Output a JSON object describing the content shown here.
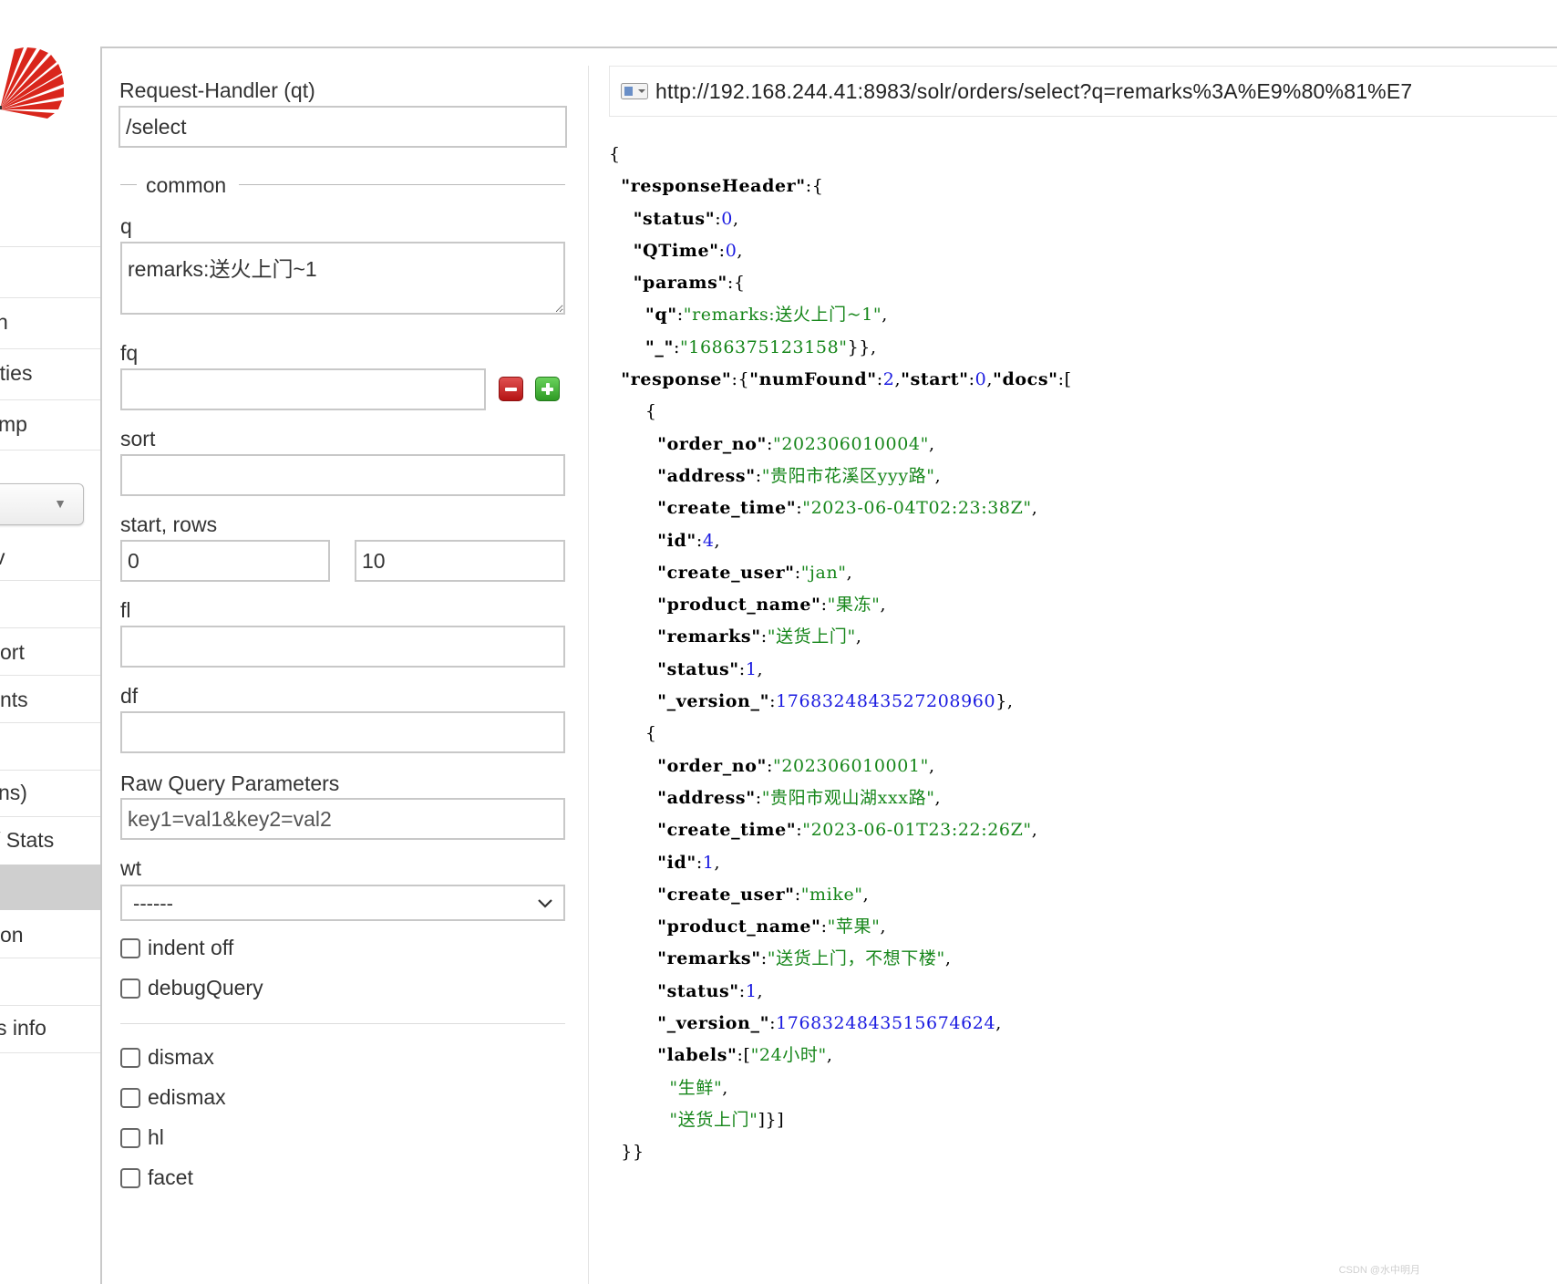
{
  "sidebar": {
    "items": [
      {
        "label": "n"
      },
      {
        "label": "rties"
      },
      {
        "label": "mp"
      },
      {
        "label": "v"
      },
      {
        "label": "ort"
      },
      {
        "label": "nts"
      },
      {
        "label": "ns)"
      },
      {
        "label": "/ Stats"
      },
      {
        "label": "on"
      },
      {
        "label": "s info"
      }
    ],
    "core_selector": {
      "value": ""
    }
  },
  "form": {
    "request_handler": {
      "label": "Request-Handler (qt)",
      "value": "/select"
    },
    "common_legend": "common",
    "q": {
      "label": "q",
      "value": "remarks:送火上门~1"
    },
    "fq": {
      "label": "fq",
      "value": ""
    },
    "sort": {
      "label": "sort",
      "value": ""
    },
    "start_rows": {
      "label": "start, rows",
      "start": "0",
      "rows": "10"
    },
    "fl": {
      "label": "fl",
      "value": ""
    },
    "df": {
      "label": "df",
      "value": ""
    },
    "raw_params": {
      "label": "Raw Query Parameters",
      "placeholder": "key1=val1&key2=val2"
    },
    "wt": {
      "label": "wt",
      "selected": "------"
    },
    "indent_off": "indent off",
    "debug_query": "debugQuery",
    "dismax": "dismax",
    "edismax": "edismax",
    "hl": "hl",
    "facet": "facet"
  },
  "results": {
    "url": "http://192.168.244.41:8983/solr/orders/select?q=remarks%3A%E9%80%81%E7",
    "json_lines": [
      [
        [
          "p",
          "{"
        ]
      ],
      [
        [
          "p",
          "  "
        ],
        [
          "k",
          "\"responseHeader\""
        ],
        [
          "p",
          ":{"
        ]
      ],
      [
        [
          "p",
          "    "
        ],
        [
          "k",
          "\"status\""
        ],
        [
          "p",
          ":"
        ],
        [
          "n",
          "0"
        ],
        [
          "p",
          ","
        ]
      ],
      [
        [
          "p",
          "    "
        ],
        [
          "k",
          "\"QTime\""
        ],
        [
          "p",
          ":"
        ],
        [
          "n",
          "0"
        ],
        [
          "p",
          ","
        ]
      ],
      [
        [
          "p",
          "    "
        ],
        [
          "k",
          "\"params\""
        ],
        [
          "p",
          ":{"
        ]
      ],
      [
        [
          "p",
          "      "
        ],
        [
          "k",
          "\"q\""
        ],
        [
          "p",
          ":"
        ],
        [
          "s",
          "\"remarks:送火上门~1\""
        ],
        [
          "p",
          ","
        ]
      ],
      [
        [
          "p",
          "      "
        ],
        [
          "k",
          "\"_\""
        ],
        [
          "p",
          ":"
        ],
        [
          "s",
          "\"1686375123158\""
        ],
        [
          "p",
          "}},"
        ]
      ],
      [
        [
          "p",
          "  "
        ],
        [
          "k",
          "\"response\""
        ],
        [
          "p",
          ":{"
        ],
        [
          "k",
          "\"numFound\""
        ],
        [
          "p",
          ":"
        ],
        [
          "n",
          "2"
        ],
        [
          "p",
          ","
        ],
        [
          "k",
          "\"start\""
        ],
        [
          "p",
          ":"
        ],
        [
          "n",
          "0"
        ],
        [
          "p",
          ","
        ],
        [
          "k",
          "\"docs\""
        ],
        [
          "p",
          ":["
        ]
      ],
      [
        [
          "p",
          "      {"
        ]
      ],
      [
        [
          "p",
          "        "
        ],
        [
          "k",
          "\"order_no\""
        ],
        [
          "p",
          ":"
        ],
        [
          "s",
          "\"202306010004\""
        ],
        [
          "p",
          ","
        ]
      ],
      [
        [
          "p",
          "        "
        ],
        [
          "k",
          "\"address\""
        ],
        [
          "p",
          ":"
        ],
        [
          "s",
          "\"贵阳市花溪区yyy路\""
        ],
        [
          "p",
          ","
        ]
      ],
      [
        [
          "p",
          "        "
        ],
        [
          "k",
          "\"create_time\""
        ],
        [
          "p",
          ":"
        ],
        [
          "s",
          "\"2023-06-04T02:23:38Z\""
        ],
        [
          "p",
          ","
        ]
      ],
      [
        [
          "p",
          "        "
        ],
        [
          "k",
          "\"id\""
        ],
        [
          "p",
          ":"
        ],
        [
          "n",
          "4"
        ],
        [
          "p",
          ","
        ]
      ],
      [
        [
          "p",
          "        "
        ],
        [
          "k",
          "\"create_user\""
        ],
        [
          "p",
          ":"
        ],
        [
          "s",
          "\"jan\""
        ],
        [
          "p",
          ","
        ]
      ],
      [
        [
          "p",
          "        "
        ],
        [
          "k",
          "\"product_name\""
        ],
        [
          "p",
          ":"
        ],
        [
          "s",
          "\"果冻\""
        ],
        [
          "p",
          ","
        ]
      ],
      [
        [
          "p",
          "        "
        ],
        [
          "k",
          "\"remarks\""
        ],
        [
          "p",
          ":"
        ],
        [
          "s",
          "\"送货上门\""
        ],
        [
          "p",
          ","
        ]
      ],
      [
        [
          "p",
          "        "
        ],
        [
          "k",
          "\"status\""
        ],
        [
          "p",
          ":"
        ],
        [
          "n",
          "1"
        ],
        [
          "p",
          ","
        ]
      ],
      [
        [
          "p",
          "        "
        ],
        [
          "k",
          "\"_version_\""
        ],
        [
          "p",
          ":"
        ],
        [
          "n",
          "1768324843527208960"
        ],
        [
          "p",
          "},"
        ]
      ],
      [
        [
          "p",
          "      {"
        ]
      ],
      [
        [
          "p",
          "        "
        ],
        [
          "k",
          "\"order_no\""
        ],
        [
          "p",
          ":"
        ],
        [
          "s",
          "\"202306010001\""
        ],
        [
          "p",
          ","
        ]
      ],
      [
        [
          "p",
          "        "
        ],
        [
          "k",
          "\"address\""
        ],
        [
          "p",
          ":"
        ],
        [
          "s",
          "\"贵阳市观山湖xxx路\""
        ],
        [
          "p",
          ","
        ]
      ],
      [
        [
          "p",
          "        "
        ],
        [
          "k",
          "\"create_time\""
        ],
        [
          "p",
          ":"
        ],
        [
          "s",
          "\"2023-06-01T23:22:26Z\""
        ],
        [
          "p",
          ","
        ]
      ],
      [
        [
          "p",
          "        "
        ],
        [
          "k",
          "\"id\""
        ],
        [
          "p",
          ":"
        ],
        [
          "n",
          "1"
        ],
        [
          "p",
          ","
        ]
      ],
      [
        [
          "p",
          "        "
        ],
        [
          "k",
          "\"create_user\""
        ],
        [
          "p",
          ":"
        ],
        [
          "s",
          "\"mike\""
        ],
        [
          "p",
          ","
        ]
      ],
      [
        [
          "p",
          "        "
        ],
        [
          "k",
          "\"product_name\""
        ],
        [
          "p",
          ":"
        ],
        [
          "s",
          "\"苹果\""
        ],
        [
          "p",
          ","
        ]
      ],
      [
        [
          "p",
          "        "
        ],
        [
          "k",
          "\"remarks\""
        ],
        [
          "p",
          ":"
        ],
        [
          "s",
          "\"送货上门，不想下楼\""
        ],
        [
          "p",
          ","
        ]
      ],
      [
        [
          "p",
          "        "
        ],
        [
          "k",
          "\"status\""
        ],
        [
          "p",
          ":"
        ],
        [
          "n",
          "1"
        ],
        [
          "p",
          ","
        ]
      ],
      [
        [
          "p",
          "        "
        ],
        [
          "k",
          "\"_version_\""
        ],
        [
          "p",
          ":"
        ],
        [
          "n",
          "1768324843515674624"
        ],
        [
          "p",
          ","
        ]
      ],
      [
        [
          "p",
          "        "
        ],
        [
          "k",
          "\"labels\""
        ],
        [
          "p",
          ":["
        ],
        [
          "s",
          "\"24小时\""
        ],
        [
          "p",
          ","
        ]
      ],
      [
        [
          "p",
          "          "
        ],
        [
          "s",
          "\"生鲜\""
        ],
        [
          "p",
          ","
        ]
      ],
      [
        [
          "p",
          "          "
        ],
        [
          "s",
          "\"送货上门\""
        ],
        [
          "p",
          "]}]"
        ]
      ],
      [
        [
          "p",
          "  }}"
        ]
      ]
    ]
  },
  "watermark": "CSDN @水中明月"
}
